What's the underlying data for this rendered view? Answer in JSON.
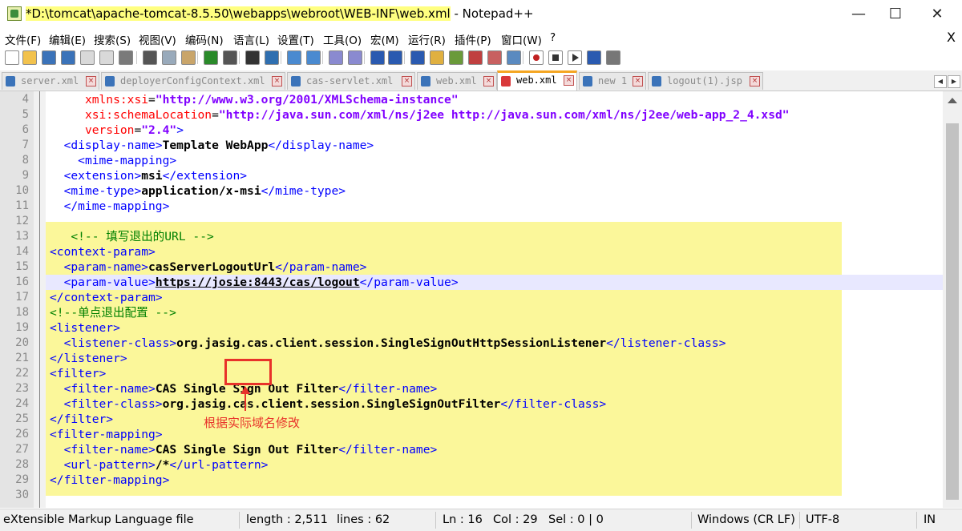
{
  "window": {
    "title_modified_mark": "*",
    "title_path": "D:\\tomcat\\apache-tomcat-8.5.50\\webapps\\webroot\\WEB-INF\\web.xml",
    "title_app": " - Notepad++",
    "minimize_glyph": "—",
    "maximize_glyph": "☐",
    "close_glyph": "✕"
  },
  "menu": {
    "items": [
      "文件(F)",
      "编辑(E)",
      "搜索(S)",
      "视图(V)",
      "编码(N)",
      "语言(L)",
      "设置(T)",
      "工具(O)",
      "宏(M)",
      "运行(R)",
      "插件(P)",
      "窗口(W)",
      "?"
    ],
    "close_glyph": "X"
  },
  "toolbar": {
    "icons": [
      "new-file-icon",
      "open-file-icon",
      "save-icon",
      "save-all-icon",
      "close-icon",
      "close-all-icon",
      "print-icon",
      "cut-icon",
      "copy-icon",
      "paste-icon",
      "undo-icon",
      "redo-icon",
      "find-icon",
      "replace-icon",
      "zoom-in-icon",
      "zoom-out-icon",
      "sync-vertical-icon",
      "sync-horizontal-icon",
      "word-wrap-icon",
      "show-all-chars-icon",
      "indent-guide-icon",
      "udl-icon",
      "doc-map-icon",
      "function-list-icon",
      "folder-workspace-icon",
      "monitoring-icon",
      "record-macro-icon",
      "stop-macro-icon",
      "play-macro-icon",
      "run-macro-multiple-icon",
      "save-macro-icon"
    ]
  },
  "tabs": [
    {
      "label": "server.xml",
      "color": "#3b73b9",
      "active": false
    },
    {
      "label": "deployerConfigContext.xml",
      "color": "#3b73b9",
      "active": false
    },
    {
      "label": "cas-servlet.xml",
      "color": "#3b73b9",
      "active": false
    },
    {
      "label": "web.xml",
      "color": "#3b73b9",
      "active": false
    },
    {
      "label": "web.xml",
      "color": "#d9383a",
      "active": true
    },
    {
      "label": "new 1",
      "color": "#3b73b9",
      "active": false
    },
    {
      "label": "logout(1).jsp",
      "color": "#3b73b9",
      "active": false
    }
  ],
  "editor": {
    "lines": [
      {
        "n": "4",
        "fold": "line",
        "parts": [
          [
            "p",
            "     "
          ],
          [
            "a",
            "xmlns:xsi"
          ],
          [
            "p",
            "="
          ],
          [
            "v",
            "\"http://www.w3.org/2001/XMLSchema-instance\""
          ]
        ]
      },
      {
        "n": "5",
        "fold": "line",
        "parts": [
          [
            "p",
            "     "
          ],
          [
            "a",
            "xsi:schemaLocation"
          ],
          [
            "p",
            "="
          ],
          [
            "v",
            "\"http://java.sun.com/xml/ns/j2ee http://java.sun.com/xml/ns/j2ee/web-app_2_4.xsd\""
          ]
        ]
      },
      {
        "n": "6",
        "fold": "line",
        "parts": [
          [
            "p",
            "     "
          ],
          [
            "a",
            "version"
          ],
          [
            "p",
            "="
          ],
          [
            "v",
            "\"2.4\""
          ],
          [
            "t",
            ">"
          ]
        ]
      },
      {
        "n": "7",
        "fold": "line",
        "parts": [
          [
            "p",
            "  "
          ],
          [
            "t",
            "<display-name>"
          ],
          [
            "x",
            "Template WebApp"
          ],
          [
            "t",
            "</display-name>"
          ]
        ]
      },
      {
        "n": "8",
        "fold": "line",
        "parts": [
          [
            "p",
            "    "
          ],
          [
            "t",
            "<mime-mapping>"
          ]
        ]
      },
      {
        "n": "9",
        "fold": "line",
        "parts": [
          [
            "p",
            "  "
          ],
          [
            "t",
            "<extension>"
          ],
          [
            "x",
            "msi"
          ],
          [
            "t",
            "</extension>"
          ]
        ]
      },
      {
        "n": "10",
        "fold": "line",
        "parts": [
          [
            "p",
            "  "
          ],
          [
            "t",
            "<mime-type>"
          ],
          [
            "x",
            "application/x-msi"
          ],
          [
            "t",
            "</mime-type>"
          ]
        ]
      },
      {
        "n": "11",
        "fold": "line",
        "parts": [
          [
            "p",
            "  "
          ],
          [
            "t",
            "</mime-mapping>"
          ]
        ]
      },
      {
        "n": "12",
        "fold": "line",
        "parts": []
      },
      {
        "n": "13",
        "fold": "line",
        "parts": [
          [
            "p",
            "   "
          ],
          [
            "c",
            "<!-- 填写退出的URL -->"
          ]
        ]
      },
      {
        "n": "14",
        "fold": "line",
        "parts": [
          [
            "t",
            "<context-param>"
          ]
        ]
      },
      {
        "n": "15",
        "fold": "line",
        "parts": [
          [
            "p",
            "  "
          ],
          [
            "t",
            "<param-name>"
          ],
          [
            "x",
            "casServerLogoutUrl"
          ],
          [
            "t",
            "</param-name>"
          ]
        ]
      },
      {
        "n": "16",
        "fold": "line",
        "parts": [
          [
            "p",
            "  "
          ],
          [
            "t",
            "<param-value>"
          ],
          [
            "u",
            "https://josie:8443/cas/logout"
          ],
          [
            "t",
            "</param-value>"
          ]
        ]
      },
      {
        "n": "17",
        "fold": "line",
        "parts": [
          [
            "t",
            "</context-param>"
          ]
        ]
      },
      {
        "n": "18",
        "fold": "line",
        "parts": [
          [
            "c",
            "<!--单点退出配置 -->"
          ]
        ]
      },
      {
        "n": "19",
        "fold": "line",
        "parts": [
          [
            "t",
            "<listener>"
          ]
        ]
      },
      {
        "n": "20",
        "fold": "line",
        "parts": [
          [
            "p",
            "  "
          ],
          [
            "t",
            "<listener-class>"
          ],
          [
            "x",
            "org.jasig.cas.client.session.SingleSignOutHttpSessionListener"
          ],
          [
            "t",
            "</listener-class>"
          ]
        ]
      },
      {
        "n": "21",
        "fold": "line",
        "parts": [
          [
            "t",
            "</listener>"
          ]
        ]
      },
      {
        "n": "22",
        "fold": "line",
        "parts": [
          [
            "t",
            "<filter>"
          ]
        ]
      },
      {
        "n": "23",
        "fold": "line",
        "parts": [
          [
            "p",
            "  "
          ],
          [
            "t",
            "<filter-name>"
          ],
          [
            "x",
            "CAS Single Sign Out Filter"
          ],
          [
            "t",
            "</filter-name>"
          ]
        ]
      },
      {
        "n": "24",
        "fold": "line",
        "parts": [
          [
            "p",
            "  "
          ],
          [
            "t",
            "<filter-class>"
          ],
          [
            "x",
            "org.jasig.cas.client.session.SingleSignOutFilter"
          ],
          [
            "t",
            "</filter-class>"
          ]
        ]
      },
      {
        "n": "25",
        "fold": "line",
        "parts": [
          [
            "t",
            "</filter>"
          ]
        ]
      },
      {
        "n": "26",
        "fold": "line",
        "parts": [
          [
            "t",
            "<filter-mapping>"
          ]
        ]
      },
      {
        "n": "27",
        "fold": "line",
        "parts": [
          [
            "p",
            "  "
          ],
          [
            "t",
            "<filter-name>"
          ],
          [
            "x",
            "CAS Single Sign Out Filter"
          ],
          [
            "t",
            "</filter-name>"
          ]
        ]
      },
      {
        "n": "28",
        "fold": "line",
        "parts": [
          [
            "p",
            "  "
          ],
          [
            "t",
            "<url-pattern>"
          ],
          [
            "x",
            "/*"
          ],
          [
            "t",
            "</url-pattern>"
          ]
        ]
      },
      {
        "n": "29",
        "fold": "line",
        "parts": [
          [
            "t",
            "</filter-mapping>"
          ]
        ]
      },
      {
        "n": "30",
        "fold": "line",
        "parts": []
      }
    ],
    "annotation_text": "根据实际域名修改"
  },
  "status": {
    "file_type": "eXtensible Markup Language file",
    "length": "length : 2,511",
    "lines": "lines : 62",
    "ln": "Ln : 16",
    "col": "Col : 29",
    "sel": "Sel : 0 | 0",
    "eol": "Windows (CR LF)",
    "encoding": "UTF-8",
    "mode": "IN"
  },
  "colors": {
    "tag": "#0000ff",
    "attribute": "#ff0000",
    "attr_value": "#8000ff",
    "comment": "#008000",
    "selection": "#fbf79a",
    "current_line": "#e8e8ff",
    "annotation": "#e8322a",
    "active_tab_accent": "#f5a623"
  }
}
